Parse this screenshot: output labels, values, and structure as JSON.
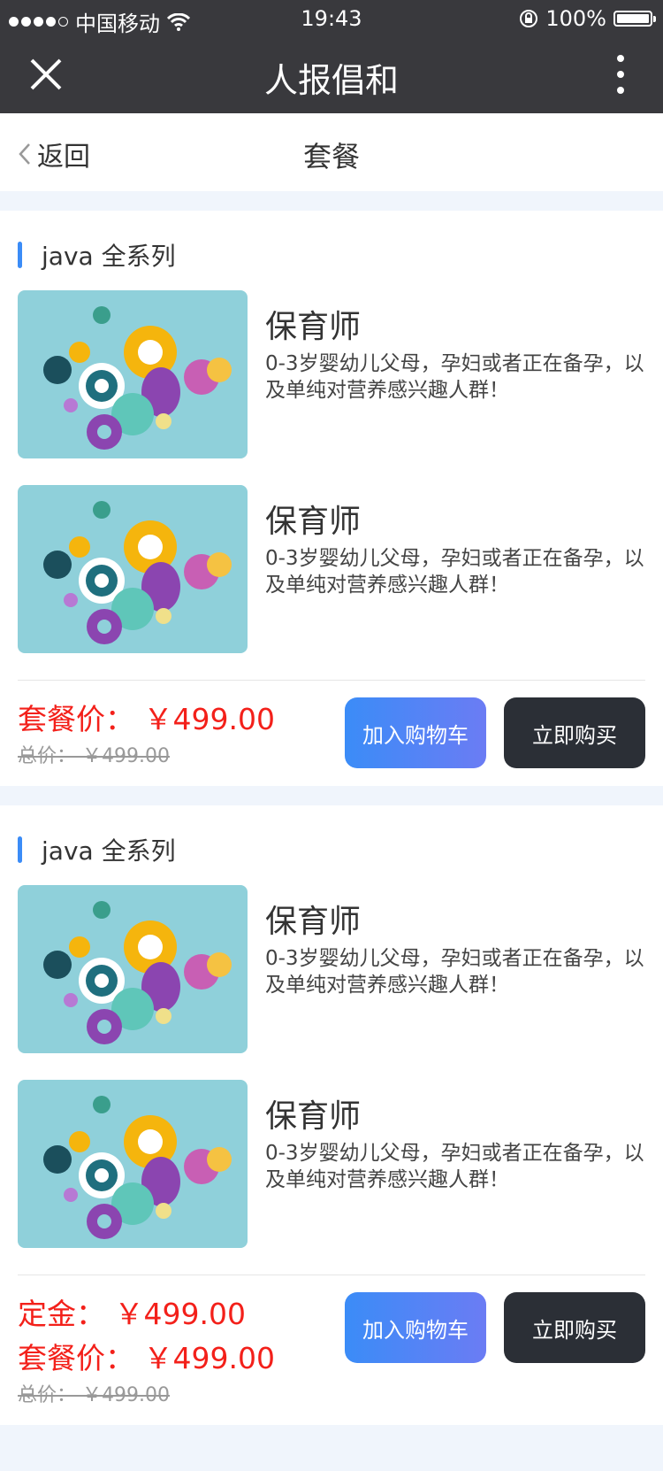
{
  "status_bar": {
    "carrier": "中国移动",
    "time": "19:43",
    "battery": "100%"
  },
  "nav": {
    "title": "人报倡和"
  },
  "subbar": {
    "back_label": "返回",
    "title": "套餐"
  },
  "packages": [
    {
      "title": "java 全系列",
      "items": [
        {
          "name": "保育师",
          "desc": "0-3岁婴幼儿父母，孕妇或者正在备孕，以及单纯对营养感兴趣人群！"
        },
        {
          "name": "保育师",
          "desc": "0-3岁婴幼儿父母，孕妇或者正在备孕，以及单纯对营养感兴趣人群！"
        }
      ],
      "package_price": "套餐价：  ￥499.00",
      "total_price": "总价：  ￥499.00",
      "cart_label": "加入购物车",
      "buy_label": "立即购买"
    },
    {
      "title": "java 全系列",
      "items": [
        {
          "name": "保育师",
          "desc": "0-3岁婴幼儿父母，孕妇或者正在备孕，以及单纯对营养感兴趣人群！"
        },
        {
          "name": "保育师",
          "desc": "0-3岁婴幼儿父母，孕妇或者正在备孕，以及单纯对营养感兴趣人群！"
        }
      ],
      "deposit_price": "定金：  ￥499.00",
      "package_price": "套餐价：  ￥499.00",
      "total_price": "总价：  ￥499.00",
      "cart_label": "加入购物车",
      "buy_label": "立即购买"
    }
  ],
  "colors": {
    "accent": "#3b8cf7",
    "price": "#f3201a",
    "dark": "#2b2f36",
    "nav_bg": "#39393d"
  }
}
